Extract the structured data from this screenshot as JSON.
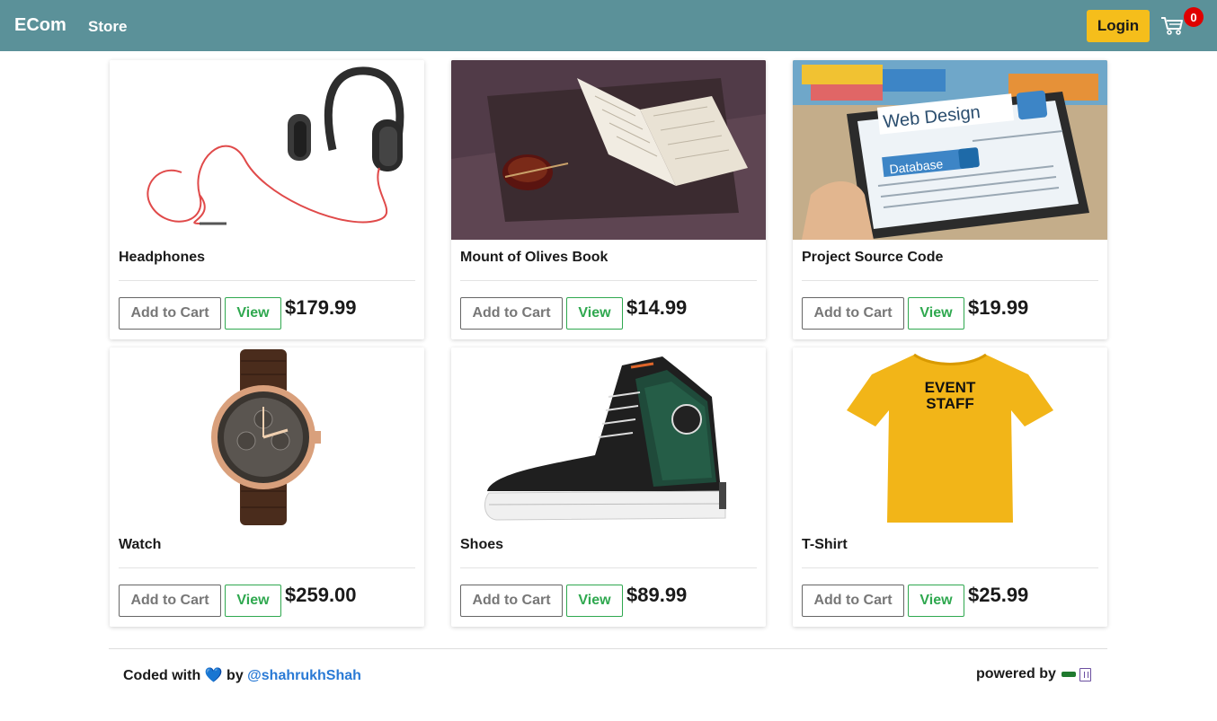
{
  "nav": {
    "brand": "ECom",
    "store": "Store",
    "login": "Login",
    "cart_count": "0"
  },
  "products": [
    {
      "title": "Headphones",
      "add_label": "Add to Cart",
      "view_label": "View",
      "price": "$179.99"
    },
    {
      "title": "Mount of Olives Book",
      "add_label": "Add to Cart",
      "view_label": "View",
      "price": "$14.99"
    },
    {
      "title": "Project Source Code",
      "add_label": "Add to Cart",
      "view_label": "View",
      "price": "$19.99"
    },
    {
      "title": "Watch",
      "add_label": "Add to Cart",
      "view_label": "View",
      "price": "$259.00"
    },
    {
      "title": "Shoes",
      "add_label": "Add to Cart",
      "view_label": "View",
      "price": "$89.99"
    },
    {
      "title": "T-Shirt",
      "add_label": "Add to Cart",
      "view_label": "View",
      "price": "$25.99"
    }
  ],
  "image_text": {
    "web_design": "Web Design",
    "database": "Database",
    "shirt_line1": "EVENT",
    "shirt_line2": "STAFF"
  },
  "footer": {
    "coded_with": "Coded with",
    "heart": "💙",
    "by": "by",
    "handle": "@shahrukhShah",
    "powered_by": "powered by"
  },
  "colors": {
    "navbar": "#5b9199",
    "login": "#f5be1b",
    "badge": "#e00000",
    "view_green": "#2fa84f"
  }
}
